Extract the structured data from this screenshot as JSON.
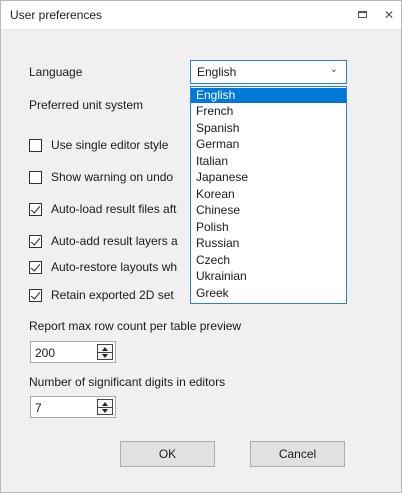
{
  "window": {
    "title": "User preferences"
  },
  "language": {
    "label": "Language",
    "selected": "English",
    "options": [
      "English",
      "French",
      "Spanish",
      "German",
      "Italian",
      "Japanese",
      "Korean",
      "Chinese",
      "Polish",
      "Russian",
      "Czech",
      "Ukrainian",
      "Greek"
    ]
  },
  "units": {
    "label": "Preferred unit system"
  },
  "checkboxes": [
    {
      "label": "Use single editor style",
      "checked": false
    },
    {
      "label": "Show warning on undo",
      "checked": false
    },
    {
      "label": "Auto-load result files aft",
      "checked": true
    },
    {
      "label": "Auto-add result layers a",
      "checked": true
    },
    {
      "label": "Auto-restore layouts wh",
      "checked": true
    },
    {
      "label": "Retain exported 2D set",
      "checked": true
    }
  ],
  "row_count": {
    "label": "Report max row count per table preview",
    "value": "200"
  },
  "sig_digits": {
    "label": "Number of significant digits in editors",
    "value": "7"
  },
  "buttons": {
    "ok": "OK",
    "cancel": "Cancel"
  }
}
